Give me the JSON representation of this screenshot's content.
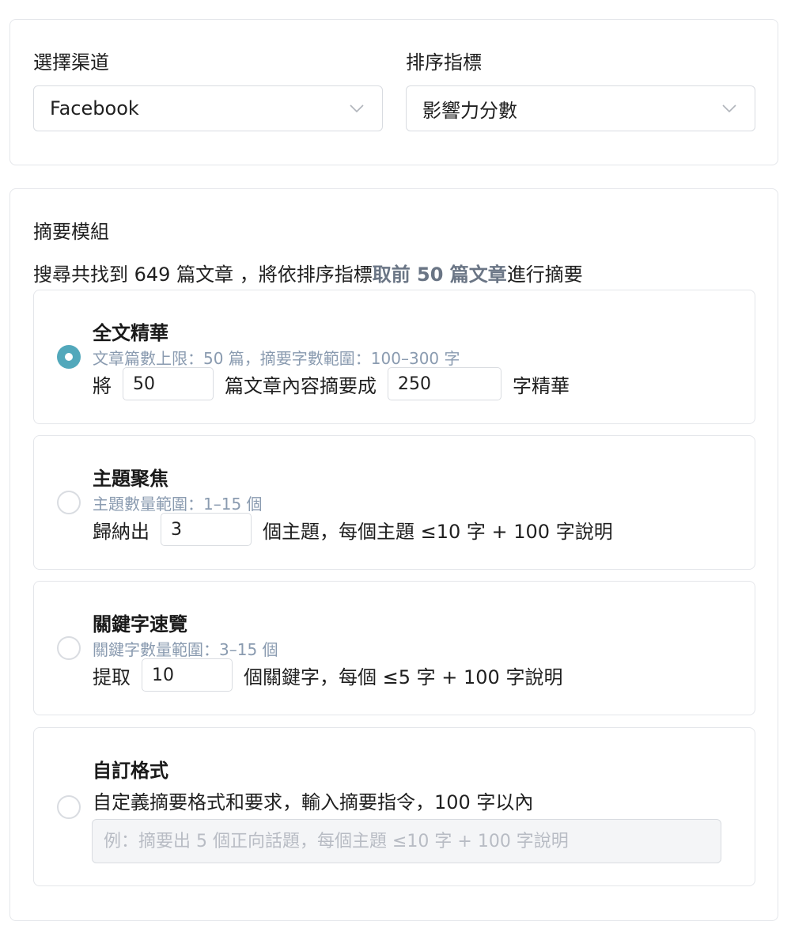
{
  "filters": {
    "channel": {
      "label": "選擇渠道",
      "value": "Facebook"
    },
    "sort": {
      "label": "排序指標",
      "value": "影響力分數"
    }
  },
  "summary": {
    "title": "摘要模組",
    "search_prefix": "搜尋共找到 649 篇文章 ，將依排序指標",
    "search_highlight": "取前 50 篇文章",
    "search_suffix": "進行摘要",
    "options": [
      {
        "title": "全文精華",
        "hint": "文章篇數上限：50 篇，摘要字數範圍：100–300 字",
        "checked": true,
        "pre": "將",
        "input1": "50",
        "mid": "篇文章內容摘要成",
        "input2": "250",
        "post": "字精華"
      },
      {
        "title": "主題聚焦",
        "hint": "主題數量範圍：1–15 個",
        "checked": false,
        "pre": "歸納出",
        "input1": "3",
        "post": "個主題，每個主題 ≤10 字 + 100 字說明"
      },
      {
        "title": "關鍵字速覽",
        "hint": "關鍵字數量範圍：3–15 個",
        "checked": false,
        "pre": "提取",
        "input1": "10",
        "post": "個關鍵字，每個 ≤5 字 + 100 字說明"
      },
      {
        "title": "自訂格式",
        "checked": false,
        "description": "自定義摘要格式和要求，輸入摘要指令，100 字以內",
        "placeholder": "例：摘要出 5 個正向話題，每個主題 ≤10 字 + 100 字說明"
      }
    ]
  },
  "colors": {
    "accent": "#52a8bb",
    "highlight": "#6a7585",
    "hint": "#8a9bb0"
  },
  "icons": {
    "select_arrow": "chevron-down-icon"
  }
}
